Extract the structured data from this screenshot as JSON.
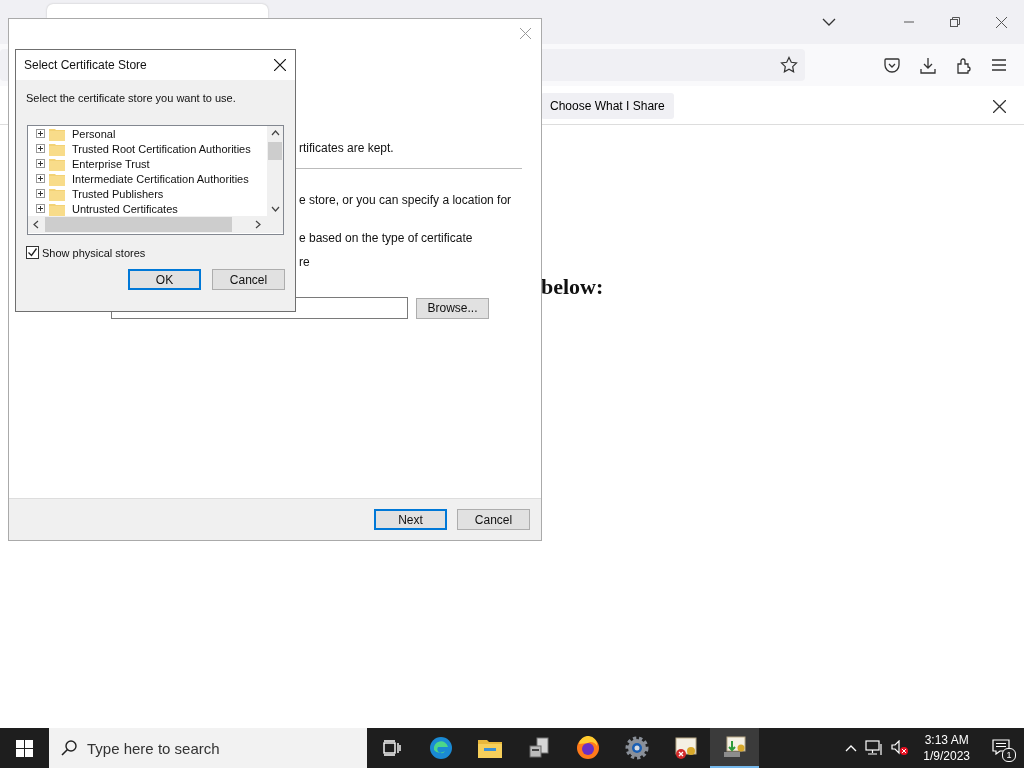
{
  "browser": {
    "notification": {
      "button": "Choose What I Share"
    },
    "page": {
      "heading": "below:"
    }
  },
  "wizard": {
    "lines": [
      "rtificates are kept.",
      "e store, or you can specify a location for",
      "e based on the type of certificate",
      "re"
    ],
    "browse_button": "Browse...",
    "next_button": "Next",
    "cancel_button": "Cancel"
  },
  "dialog": {
    "title": "Select Certificate Store",
    "instruction": "Select the certificate store you want to use.",
    "tree": [
      {
        "label": "Personal",
        "expanded": false
      },
      {
        "label": "Trusted Root Certification Authorities",
        "expanded": false
      },
      {
        "label": "Enterprise Trust",
        "expanded": false
      },
      {
        "label": "Intermediate Certification Authorities",
        "expanded": false
      },
      {
        "label": "Trusted Publishers",
        "expanded": false
      },
      {
        "label": "Untrusted Certificates",
        "expanded": false
      }
    ],
    "show_physical_stores": {
      "label": "Show physical stores",
      "checked": true
    },
    "ok_button": "OK",
    "cancel_button": "Cancel"
  },
  "taskbar": {
    "search_placeholder": "Type here to search",
    "apps": [
      {
        "kind": "taskview",
        "active": false
      },
      {
        "kind": "edge",
        "active": false
      },
      {
        "kind": "explorer",
        "active": false
      },
      {
        "kind": "server",
        "active": false
      },
      {
        "kind": "firefox",
        "active": false
      },
      {
        "kind": "settings",
        "active": false
      },
      {
        "kind": "certerror",
        "active": false
      },
      {
        "kind": "certinstall",
        "active": true
      }
    ],
    "time": "3:13 AM",
    "date": "1/9/2023",
    "notification_count": "1"
  }
}
